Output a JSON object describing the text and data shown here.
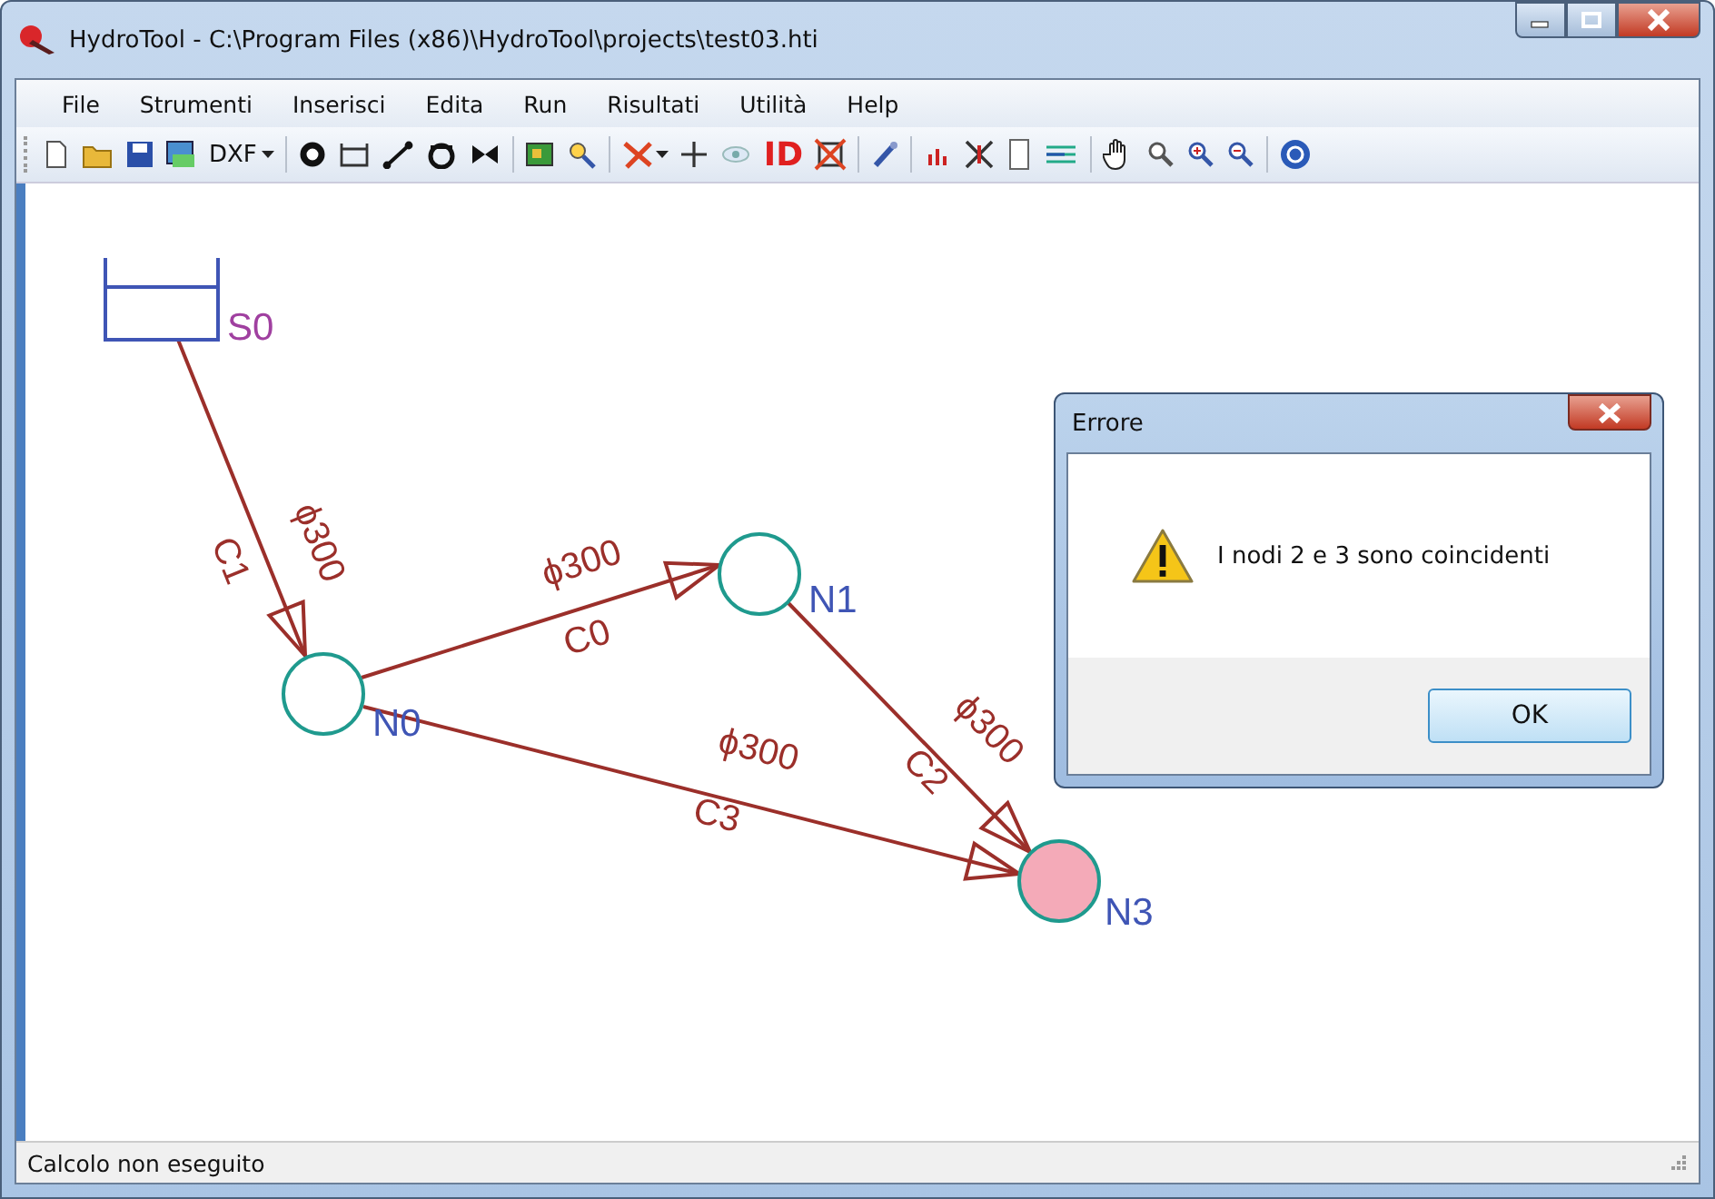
{
  "window": {
    "title": "HydroTool - C:\\Program Files (x86)\\HydroTool\\projects\\test03.hti"
  },
  "menu": [
    "File",
    "Strumenti",
    "Inserisci",
    "Edita",
    "Run",
    "Risultati",
    "Utilità",
    "Help"
  ],
  "toolbar": {
    "dxf_label": "DXF",
    "id_label": "ID"
  },
  "network": {
    "nodes": [
      {
        "label": "S0",
        "kind": "reservoir",
        "highlighted": false
      },
      {
        "label": "N0",
        "kind": "junction",
        "highlighted": false
      },
      {
        "label": "N1",
        "kind": "junction",
        "highlighted": false
      },
      {
        "label": "N3",
        "kind": "junction",
        "highlighted": true
      }
    ],
    "pipes": [
      {
        "name": "C1",
        "diameter": "ϕ300"
      },
      {
        "name": "C0",
        "diameter": "ϕ300"
      },
      {
        "name": "C2",
        "diameter": "ϕ300"
      },
      {
        "name": "C3",
        "diameter": "ϕ300"
      }
    ]
  },
  "dialog": {
    "title": "Errore",
    "message": "I nodi 2 e 3 sono coincidenti",
    "button": "OK"
  },
  "status_bar": "Calcolo non eseguito"
}
